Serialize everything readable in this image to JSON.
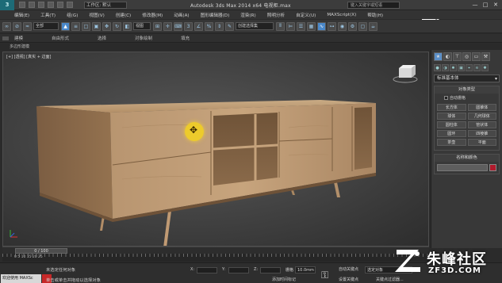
{
  "titlebar": {
    "logo": "3",
    "workspace": "工作区: 默认",
    "app_title": "Autodesk 3ds Max  2014 x64      电视柜.max",
    "search_placeholder": "键入关键字或短语",
    "window_buttons": [
      "—",
      "□",
      "✕"
    ]
  },
  "menu": [
    "编辑(E)",
    "工具(T)",
    "组(G)",
    "视图(V)",
    "创建(C)",
    "修改器(M)",
    "动画(A)",
    "图形编辑器(D)",
    "渲染(R)",
    "照明分析",
    "自定义(U)",
    "MAXScript(X)",
    "帮助(H)"
  ],
  "toolbar": {
    "filter": "全部",
    "ref_coord": "视图",
    "selection_set": "创建选择集"
  },
  "ribbon": {
    "tabs": [
      "建模",
      "自由形式",
      "选择",
      "对象绘制",
      "填充"
    ],
    "sub_label": "多边形建模"
  },
  "viewport": {
    "label": "[+] [透视] [真实 + 边面]"
  },
  "command_panel": {
    "tab_icons": [
      "create-tab",
      "modify-tab",
      "hierarchy-tab",
      "motion-tab",
      "display-tab",
      "utilities-tab"
    ],
    "category": "标准基本体",
    "rollout_object_type": "对象类型",
    "auto_grid": "自动栅格",
    "object_buttons": [
      "长方体",
      "圆锥体",
      "球体",
      "几何球体",
      "圆柱体",
      "管状体",
      "圆环",
      "四棱锥",
      "茶壶",
      "平面"
    ],
    "rollout_name_color": "名称和颜色",
    "object_color": "#b01a2c"
  },
  "timeline": {
    "slider": "0 / 100",
    "ruler_label": "0    5   10   15   20   25"
  },
  "status": {
    "listener": "欢迎使用 MAXSc",
    "line1": "未选定任何对象",
    "line2": "单击或单击并拖动以选择对象",
    "x_label": "X:",
    "y_label": "Y:",
    "z_label": "Z:",
    "grid_label": "栅格",
    "grid_value": "10.0mm",
    "add_time_tag": "添加时间标记",
    "auto_key": "自动关键点",
    "set_key": "设置关键点",
    "selection_filter": "选定对象",
    "key_filters": "关键点过滤器..."
  },
  "watermark": {
    "title": "朱峰社区",
    "url": "ZF3D.COM"
  }
}
